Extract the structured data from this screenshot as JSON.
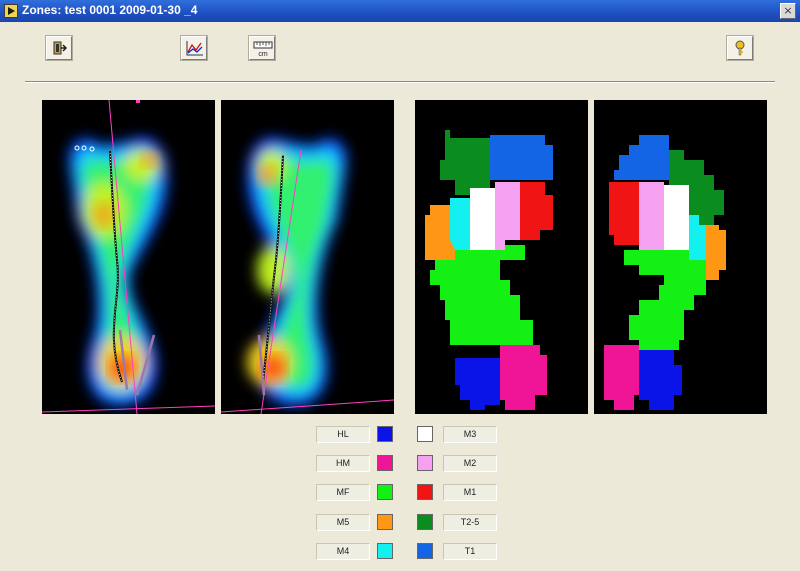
{
  "window": {
    "title": "Zones: test 0001 2009-01-30 _4",
    "close_glyph": "×"
  },
  "toolbar": {
    "exit_icon": "exit-door-icon",
    "graph_icon": "line-graph-icon",
    "ruler_label": "cm",
    "help_icon": "help-key-icon"
  },
  "legend": {
    "left": [
      {
        "label": "HL",
        "color": "#0a14e6"
      },
      {
        "label": "HM",
        "color": "#f01496"
      },
      {
        "label": "MF",
        "color": "#14f014"
      },
      {
        "label": "M5",
        "color": "#ff9614"
      },
      {
        "label": "M4",
        "color": "#14f0f0"
      }
    ],
    "right": [
      {
        "label": "M3",
        "color": "#ffffff"
      },
      {
        "label": "M2",
        "color": "#f5a0f0"
      },
      {
        "label": "M1",
        "color": "#f01414"
      },
      {
        "label": "T2-5",
        "color": "#0a8c1e"
      },
      {
        "label": "T1",
        "color": "#1464e6"
      }
    ]
  }
}
